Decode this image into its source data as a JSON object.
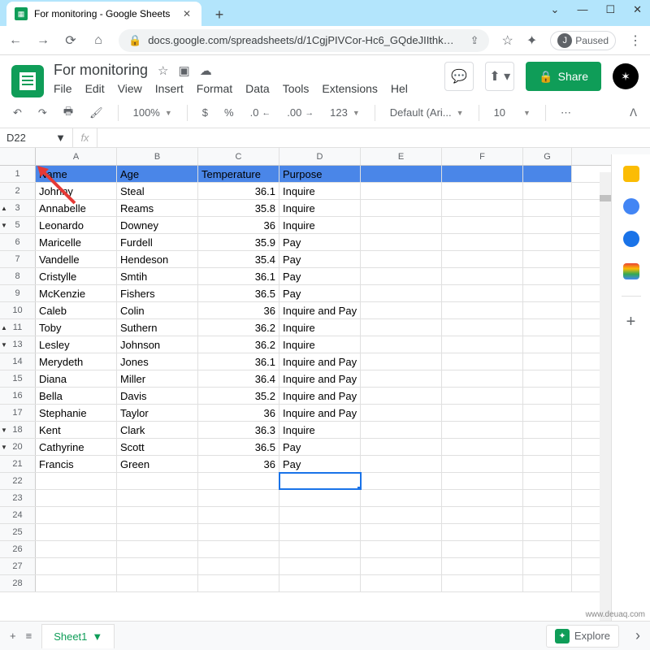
{
  "browser": {
    "tab_title": "For monitoring - Google Sheets",
    "url": "docs.google.com/spreadsheets/d/1CgjPIVCor-Hc6_GQdeJIIthk…",
    "profile_label": "Paused",
    "profile_initial": "J"
  },
  "doc": {
    "title": "For monitoring",
    "share_label": "Share"
  },
  "menus": [
    "File",
    "Edit",
    "View",
    "Insert",
    "Format",
    "Data",
    "Tools",
    "Extensions",
    "Hel"
  ],
  "toolbar": {
    "zoom": "100%",
    "currency": "$",
    "percent": "%",
    "dec_dec": ".0",
    "dec_inc": ".00",
    "numfmt": "123",
    "font": "Default (Ari...",
    "fontsize": "10"
  },
  "namebox": "D22",
  "columns": [
    "A",
    "B",
    "C",
    "D",
    "E",
    "F",
    "G"
  ],
  "header_row": {
    "num": "1",
    "A": "Name",
    "B": "Age",
    "C": "Temperature",
    "D": "Purpose"
  },
  "rows": [
    {
      "num": "2",
      "A": "Johnny",
      "B": "Steal",
      "C": "36.1",
      "D": "Inquire",
      "marker": ""
    },
    {
      "num": "3",
      "A": "Annabelle",
      "B": "Reams",
      "C": "35.8",
      "D": "Inquire",
      "marker": "▲"
    },
    {
      "num": "5",
      "A": "Leonardo",
      "B": "Downey",
      "C": "36",
      "D": "Inquire",
      "marker": "▼"
    },
    {
      "num": "6",
      "A": "Maricelle",
      "B": "Furdell",
      "C": "35.9",
      "D": "Pay",
      "marker": ""
    },
    {
      "num": "7",
      "A": "Vandelle",
      "B": "Hendeson",
      "C": "35.4",
      "D": "Pay",
      "marker": ""
    },
    {
      "num": "8",
      "A": "Cristylle",
      "B": "Smtih",
      "C": "36.1",
      "D": "Pay",
      "marker": ""
    },
    {
      "num": "9",
      "A": "McKenzie",
      "B": "Fishers",
      "C": "36.5",
      "D": "Pay",
      "marker": ""
    },
    {
      "num": "10",
      "A": "Caleb",
      "B": "Colin",
      "C": "36",
      "D": "Inquire and Pay",
      "marker": ""
    },
    {
      "num": "11",
      "A": "Toby",
      "B": "Suthern",
      "C": "36.2",
      "D": "Inquire",
      "marker": "▲"
    },
    {
      "num": "13",
      "A": "Lesley",
      "B": "Johnson",
      "C": "36.2",
      "D": "Inquire",
      "marker": "▼"
    },
    {
      "num": "14",
      "A": "Merydeth",
      "B": "Jones",
      "C": "36.1",
      "D": "Inquire and Pay",
      "marker": ""
    },
    {
      "num": "15",
      "A": "Diana",
      "B": "Miller",
      "C": "36.4",
      "D": "Inquire and Pay",
      "marker": ""
    },
    {
      "num": "16",
      "A": "Bella",
      "B": "Davis",
      "C": "35.2",
      "D": "Inquire and Pay",
      "marker": ""
    },
    {
      "num": "17",
      "A": "Stephanie",
      "B": "Taylor",
      "C": "36",
      "D": "Inquire and Pay",
      "marker": ""
    },
    {
      "num": "18",
      "A": "Kent",
      "B": "Clark",
      "C": "36.3",
      "D": "Inquire",
      "marker": "▼"
    },
    {
      "num": "20",
      "A": "Cathyrine",
      "B": "Scott",
      "C": "36.5",
      "D": "Pay",
      "marker": "▼"
    },
    {
      "num": "21",
      "A": "Francis",
      "B": "Green",
      "C": "36",
      "D": "Pay",
      "marker": ""
    },
    {
      "num": "22",
      "A": "",
      "B": "",
      "C": "",
      "D": "",
      "marker": ""
    },
    {
      "num": "23",
      "A": "",
      "B": "",
      "C": "",
      "D": "",
      "marker": ""
    },
    {
      "num": "24",
      "A": "",
      "B": "",
      "C": "",
      "D": "",
      "marker": ""
    },
    {
      "num": "25",
      "A": "",
      "B": "",
      "C": "",
      "D": "",
      "marker": ""
    },
    {
      "num": "26",
      "A": "",
      "B": "",
      "C": "",
      "D": "",
      "marker": ""
    },
    {
      "num": "27",
      "A": "",
      "B": "",
      "C": "",
      "D": "",
      "marker": ""
    },
    {
      "num": "28",
      "A": "",
      "B": "",
      "C": "",
      "D": "",
      "marker": ""
    }
  ],
  "sheet_tab": "Sheet1",
  "explore": "Explore",
  "watermark": "www.deuaq.com",
  "chart_data": {
    "type": "table",
    "columns": [
      "Name",
      "Age",
      "Temperature",
      "Purpose"
    ],
    "data": [
      [
        "Johnny",
        "Steal",
        36.1,
        "Inquire"
      ],
      [
        "Annabelle",
        "Reams",
        35.8,
        "Inquire"
      ],
      [
        "Leonardo",
        "Downey",
        36,
        "Inquire"
      ],
      [
        "Maricelle",
        "Furdell",
        35.9,
        "Pay"
      ],
      [
        "Vandelle",
        "Hendeson",
        35.4,
        "Pay"
      ],
      [
        "Cristylle",
        "Smtih",
        36.1,
        "Pay"
      ],
      [
        "McKenzie",
        "Fishers",
        36.5,
        "Pay"
      ],
      [
        "Caleb",
        "Colin",
        36,
        "Inquire and Pay"
      ],
      [
        "Toby",
        "Suthern",
        36.2,
        "Inquire"
      ],
      [
        "Lesley",
        "Johnson",
        36.2,
        "Inquire"
      ],
      [
        "Merydeth",
        "Jones",
        36.1,
        "Inquire and Pay"
      ],
      [
        "Diana",
        "Miller",
        36.4,
        "Inquire and Pay"
      ],
      [
        "Bella",
        "Davis",
        35.2,
        "Inquire and Pay"
      ],
      [
        "Stephanie",
        "Taylor",
        36,
        "Inquire and Pay"
      ],
      [
        "Kent",
        "Clark",
        36.3,
        "Inquire"
      ],
      [
        "Cathyrine",
        "Scott",
        36.5,
        "Pay"
      ],
      [
        "Francis",
        "Green",
        36,
        "Pay"
      ]
    ]
  }
}
